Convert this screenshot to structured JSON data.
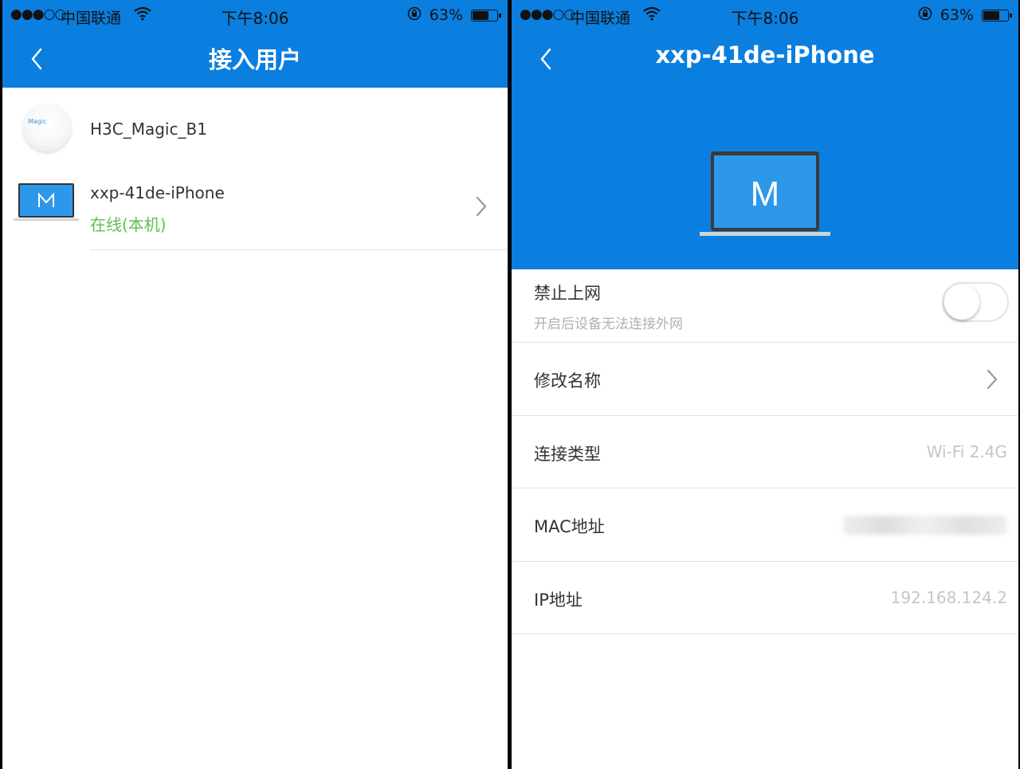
{
  "status": {
    "signal": "●●●○○",
    "carrier": "中国联通",
    "time": "下午8:06",
    "battery": "63%",
    "battery_level": 0.63
  },
  "left": {
    "title": "接入用户",
    "devices": [
      {
        "name": "H3C_Magic_B1",
        "icon": "router-icon",
        "icon_text": "Magic"
      },
      {
        "name": "xxp-41de-iPhone",
        "status": "在线(本机)",
        "icon": "laptop-icon"
      }
    ]
  },
  "right": {
    "title": "xxp-41de-iPhone",
    "hero_letter": "M",
    "block_internet": {
      "label": "禁止上网",
      "hint": "开启后设备无法连接外网",
      "enabled": false
    },
    "rename": {
      "label": "修改名称"
    },
    "connection_type": {
      "label": "连接类型",
      "value": "Wi-Fi 2.4G"
    },
    "mac": {
      "label": "MAC地址"
    },
    "ip": {
      "label": "IP地址",
      "value": "192.168.124.2"
    }
  },
  "colors": {
    "primary": "#0a7fdf",
    "online": "#5bc04a",
    "laptop_screen": "#2d98ea"
  }
}
